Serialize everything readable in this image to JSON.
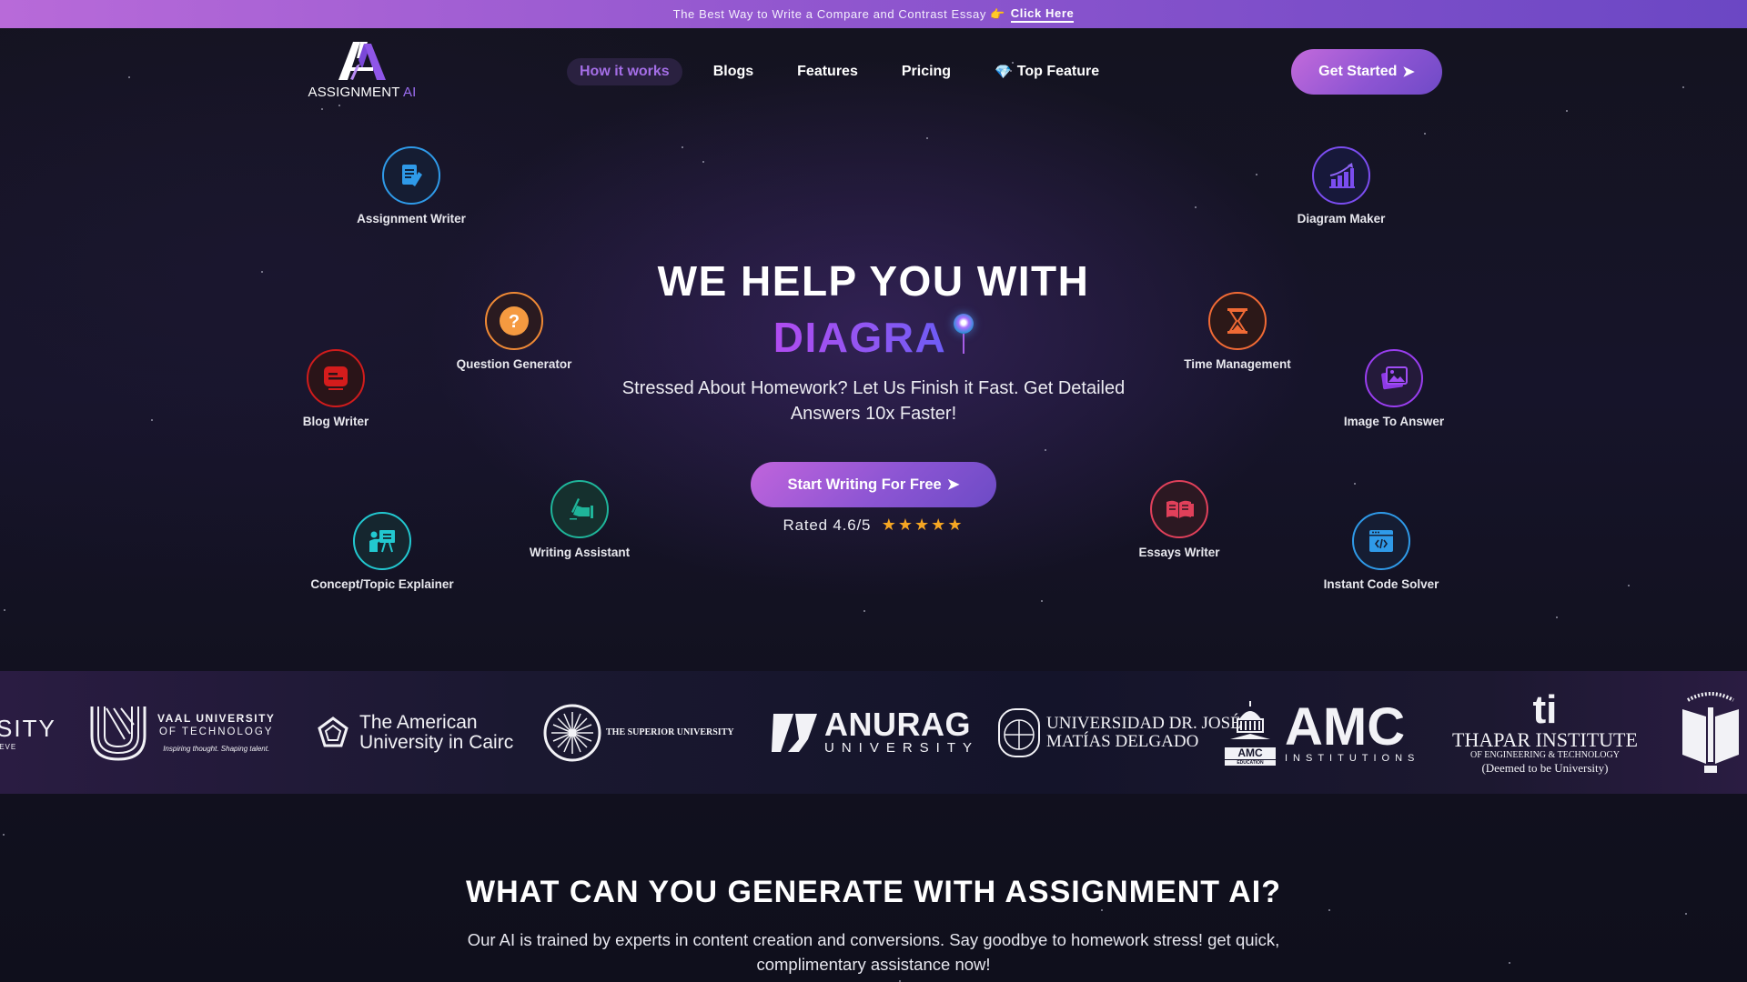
{
  "banner": {
    "text": "The Best Way to Write a Compare and Contrast Essay",
    "hand_icon": "👉",
    "link_label": "Click Here"
  },
  "header": {
    "logo_text": "ASSIGNMENT",
    "logo_text_accent": "AI",
    "nav": [
      {
        "label": "How it works",
        "active": true
      },
      {
        "label": "Blogs"
      },
      {
        "label": "Features"
      },
      {
        "label": "Pricing"
      },
      {
        "label": "Top Feature",
        "icon": "💎"
      }
    ],
    "cta_label": "Get Started",
    "cta_arrow": "➤"
  },
  "features": [
    {
      "label": "Assignment Writer",
      "icon": "document-pencil-icon",
      "color": "#2f9ae8"
    },
    {
      "label": "Diagram Maker",
      "icon": "bar-chart-growth-icon",
      "color": "#7b4df0"
    },
    {
      "label": "Question Generator",
      "icon": "question-icon",
      "color": "#f08a35"
    },
    {
      "label": "Time Management",
      "icon": "hourglass-icon",
      "color": "#f06a35"
    },
    {
      "label": "Blog Writer",
      "icon": "blog-monitor-icon",
      "color": "#d01c1c"
    },
    {
      "label": "Image To Answer",
      "icon": "image-gallery-icon",
      "color": "#9a3ef0"
    },
    {
      "label": "Writing Assistant",
      "icon": "hand-writing-icon",
      "color": "#1fb59a"
    },
    {
      "label": "Essays Writer",
      "icon": "open-book-icon",
      "color": "#e0405a"
    },
    {
      "label": "Concept/Topic Explainer",
      "icon": "teacher-board-icon",
      "color": "#22c8d0"
    },
    {
      "label": "Instant Code Solver",
      "icon": "code-window-icon",
      "color": "#2f9ae8"
    }
  ],
  "hero": {
    "title": "WE HELP YOU WITH",
    "typed_word": "DIAGRA",
    "subtitle": "Stressed About Homework? Let Us Finish it Fast. Get Detailed Answers 10x Faster!",
    "cta_label": "Start Writing For Free",
    "cta_arrow": "➤",
    "rating_text": "Rated 4.6/5",
    "rating_value": 4.6,
    "rating_max": 5,
    "stars": "★★★★★"
  },
  "universities": [
    {
      "name": "SITY",
      "sub": "IEVE"
    },
    {
      "name": "VAAL UNIVERSITY",
      "line2": "OF TECHNOLOGY",
      "tagline": "Inspiring thought. Shaping talent."
    },
    {
      "name": "The American",
      "line2": "University in Cairc"
    },
    {
      "name": "THE SUPERIOR UNIVERSITY"
    },
    {
      "name": "ANURAG",
      "line2": "UNIVERSITY"
    },
    {
      "name": "UNIVERSIDAD DR. JOSÉ",
      "line2": "MATÍAS DELGADO"
    },
    {
      "name": "AMC",
      "line2": "INSTITUTIONS",
      "badge": "AMC",
      "badge_sub": "EDUCATION"
    },
    {
      "name": "THAPAR INSTITUTE",
      "line2": "OF ENGINEERING & TECHNOLOGY",
      "line3": "(Deemed to be University)",
      "mark": "ti"
    }
  ],
  "section2": {
    "title": "WHAT CAN YOU GENERATE WITH ASSIGNMENT AI?",
    "text": "Our AI is trained by experts in content creation and conversions. Say goodbye to homework stress! get quick, complimentary assistance now!"
  }
}
